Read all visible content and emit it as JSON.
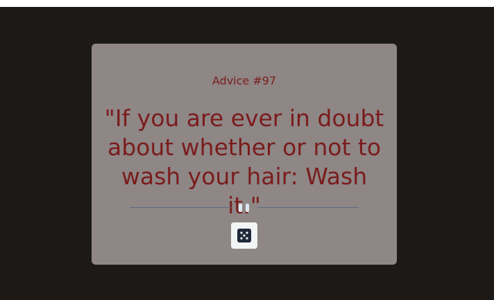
{
  "advice": {
    "heading": "Advice #97",
    "quote": "\"If you are ever in doubt about whether or not to wash your hair: Wash it.\""
  },
  "icons": {
    "divider": "pause-icon",
    "button": "dice-icon"
  },
  "colors": {
    "background": "#1c1917",
    "card": "#8f8686",
    "text": "#7a1c1c",
    "button": "#f3f4f6"
  }
}
